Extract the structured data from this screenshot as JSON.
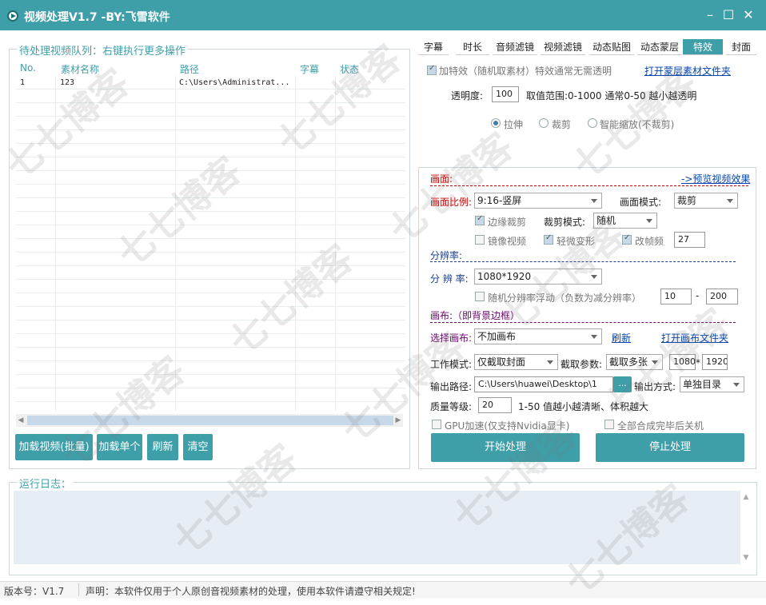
{
  "window": {
    "title": "视频处理V1.7 -BY:飞雪软件"
  },
  "queue": {
    "legend": "待处理视频队列：右键执行更多操作",
    "columns": [
      "No.",
      "素材名称",
      "路径",
      "字幕",
      "状态"
    ],
    "rows": [
      {
        "no": "1",
        "name": "123",
        "path": "C:\\Users\\Administrat...",
        "subtitle": "",
        "status": ""
      }
    ],
    "buttons": {
      "load_batch": "加载视频(批量)",
      "load_single": "加载单个",
      "refresh": "刷新",
      "clear": "清空"
    }
  },
  "tabs": [
    "字幕",
    "时长",
    "音频滤镜",
    "视频滤镜",
    "动态贴图",
    "动态蒙层",
    "特效",
    "封面"
  ],
  "active_tab": "特效",
  "effects": {
    "add_effect": "加特效（随机取素材）特效通常无需透明",
    "open_mask_folder": "打开蒙层素材文件夹",
    "opacity_label": "透明度:",
    "opacity_value": "100",
    "opacity_hint": "取值范围:0-1000 通常0-50 越小越透明",
    "radio_stretch": "拉伸",
    "radio_crop": "裁剪",
    "radio_smart": "智能缩放(不裁剪)"
  },
  "frame": {
    "section": "画面:",
    "preview_link": "->预览视频效果",
    "ratio_label": "画面比例:",
    "ratio_value": "9:16-竖屏",
    "mode_label": "画面模式:",
    "mode_value": "裁剪",
    "edge_crop": "边缘裁剪",
    "crop_mode_label": "裁剪模式:",
    "crop_mode_value": "随机",
    "mirror": "镜像视频",
    "slight_deform": "轻微变形",
    "change_fps": "改帧频",
    "fps_value": "27"
  },
  "resolution": {
    "section": "分辨率:",
    "label": "分 辨 率:",
    "value": "1080*1920",
    "random_float": "随机分辨率浮动（负数为减分辨率）",
    "min": "10",
    "dash": "-",
    "max": "200"
  },
  "canvas": {
    "section": "画布:（即背景边框）",
    "label": "选择画布:",
    "value": "不加画布",
    "refresh": "刷新",
    "open_folder": "打开画布文件夹"
  },
  "work": {
    "mode_label": "工作模式:",
    "mode_value": "仅截取封面",
    "capture_label": "截取参数:",
    "capture_value": "截取多张",
    "width": "1080",
    "times": "*",
    "height": "1920",
    "output_label": "输出路径:",
    "output_path": "C:\\Users\\huawei\\Desktop\\1",
    "browse": "...",
    "output_mode_label": "输出方式:",
    "output_mode_value": "单独目录",
    "quality_label": "质量等级:",
    "quality_value": "20",
    "quality_hint": "1-50 值越小越清晰、体积越大",
    "gpu": "GPU加速(仅支持Nvidia显卡)",
    "shutdown": "全部合成完毕后关机",
    "start": "开始处理",
    "stop": "停止处理"
  },
  "log": {
    "legend": "运行日志："
  },
  "status": {
    "version": "版本号：V1.7",
    "notice": "声明：本软件仅用于个人原创音视频素材的处理，使用本软件请遵守相关规定!"
  },
  "watermark": "七七博客",
  "colors": {
    "accent": "#3f9fa8",
    "section_red": "#cc0000",
    "section_blue": "#1a3d8f",
    "link": "#0645ad"
  }
}
